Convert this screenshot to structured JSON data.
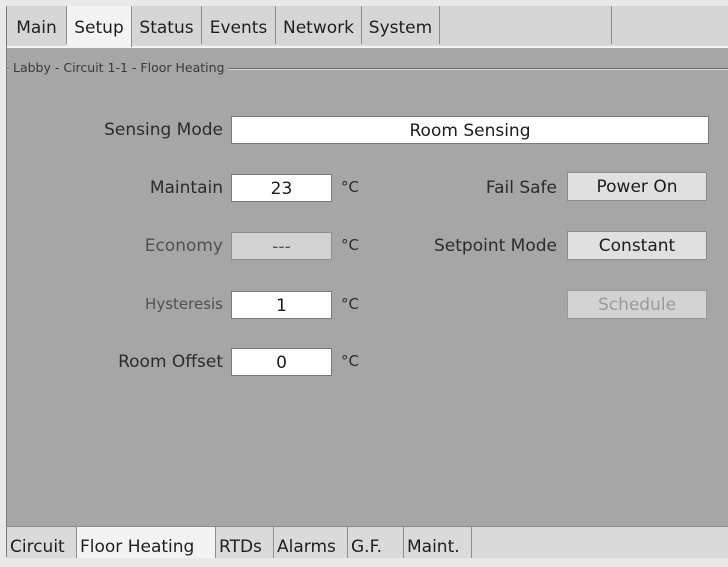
{
  "top_tabs": [
    {
      "label": "Main",
      "active": false
    },
    {
      "label": "Setup",
      "active": true
    },
    {
      "label": "Status",
      "active": false
    },
    {
      "label": "Events",
      "active": false
    },
    {
      "label": "Network",
      "active": false
    },
    {
      "label": "System",
      "active": false
    }
  ],
  "group_title": "Labby - Circuit 1-1 - Floor Heating",
  "sensing_mode": {
    "label": "Sensing Mode",
    "value": "Room Sensing"
  },
  "maintain": {
    "label": "Maintain",
    "value": "23",
    "unit": "°C"
  },
  "economy": {
    "label": "Economy",
    "value": "---",
    "unit": "°C"
  },
  "hysteresis": {
    "label": "Hysteresis",
    "value": "1",
    "unit": "°C"
  },
  "room_offset": {
    "label": "Room Offset",
    "value": "0",
    "unit": "°C"
  },
  "fail_safe": {
    "label": "Fail Safe",
    "value": "Power On"
  },
  "setpoint_mode": {
    "label": "Setpoint Mode",
    "value": "Constant"
  },
  "schedule_button": {
    "label": "Schedule",
    "enabled": false
  },
  "bottom_tabs": [
    {
      "label": "Circuit",
      "active": false
    },
    {
      "label": "Floor Heating",
      "active": true
    },
    {
      "label": "RTDs",
      "active": false
    },
    {
      "label": "Alarms",
      "active": false
    },
    {
      "label": "G.F.",
      "active": false
    },
    {
      "label": "Maint.",
      "active": false
    }
  ],
  "colors": {
    "panel_background": "#a6a6a6",
    "active_tab": "#f3f3f3",
    "field_background": "#ffffff"
  }
}
